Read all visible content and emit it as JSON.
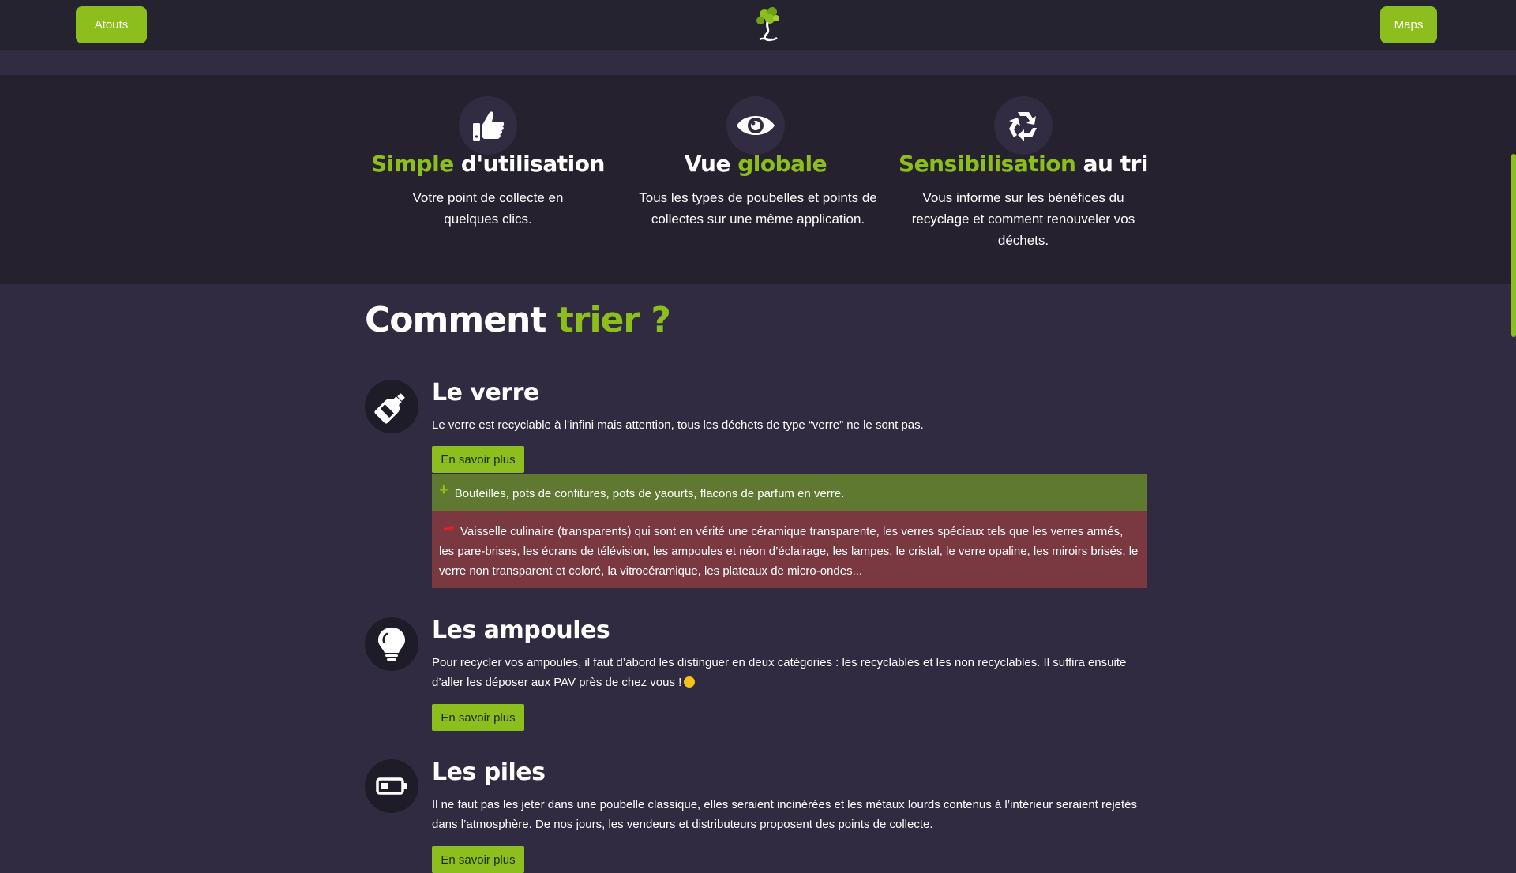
{
  "header": {
    "left_button": "Atouts",
    "right_button": "Maps",
    "logo_icon": "tree-logo-icon"
  },
  "features": [
    {
      "icon": "thumbs-up-icon",
      "title_accent": "Simple",
      "title_rest": " d'utilisation",
      "text": "Votre point de collecte en quelques clics."
    },
    {
      "icon": "eye-icon",
      "title_rest_first": "Vue ",
      "title_accent": "globale",
      "text": "Tous les types de poubelles et points de collectes sur une même application."
    },
    {
      "icon": "recycle-icon",
      "title_accent": "Sensibilisation",
      "title_rest": " au tri",
      "text": "Vous informe sur les bénéfices du recyclage et comment renouveler vos déchets."
    }
  ],
  "section": {
    "title_plain": "Comment ",
    "title_accent": "trier ?"
  },
  "items": [
    {
      "icon": "bottle-icon",
      "title": "Le verre",
      "text": "Le verre est recyclable à l’infini mais attention, tous les déchets de type “verre” ne le sont pas.",
      "button": "En savoir plus",
      "yes": "Bouteilles, pots de confitures, pots de yaourts, flacons de parfum en verre.",
      "no": "Vaisselle culinaire (transparents) qui sont en vérité une céramique transparente, les verres spéciaux tels que les verres armés, les pare-brises, les écrans de télévision, les ampoules et néon d’éclairage, les lampes, le cristal, le verre opaline, les miroirs brisés, le verre non transparent et coloré, la vitrocéramique, les plateaux de micro-ondes..."
    },
    {
      "icon": "lightbulb-icon",
      "title": "Les ampoules",
      "text": "Pour recycler vos ampoules, il faut d’abord les distinguer en deux catégories : les recyclables et les non recyclables. Il suffira ensuite d’aller les déposer aux PAV près de chez vous !",
      "button": "En savoir plus"
    },
    {
      "icon": "battery-icon",
      "title": "Les piles",
      "text": "Il ne faut pas les jeter dans une poubelle classique, elles seraient incinérées et les métaux lourds contenus à l’intérieur seraient rejetés dans l’atmosphère. De nos jours, les vendeurs et distributeurs proposent des points de collecte.",
      "button": "En savoir plus"
    }
  ],
  "colors": {
    "accent": "#8cbf1d",
    "page_bg": "#302b40",
    "band_bg": "#25212f",
    "yes_bg": "#5f7a30",
    "no_bg": "#7a3841"
  }
}
